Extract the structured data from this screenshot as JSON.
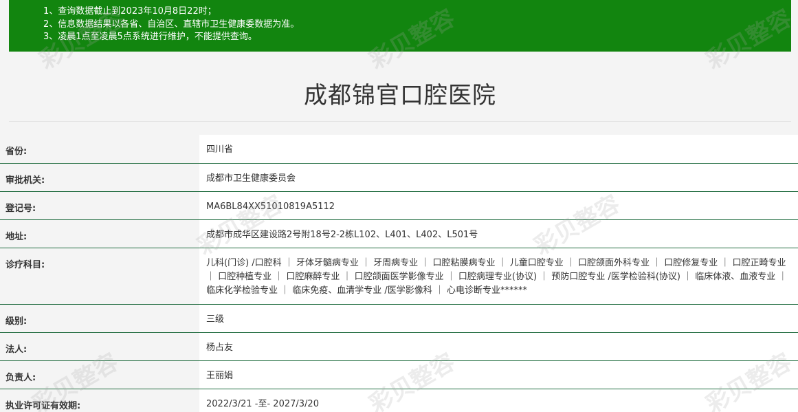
{
  "notice": {
    "line1": "1、查询数据截止到2023年10月8日22时；",
    "line2": "2、信息数据结果以各省、自治区、直辖市卫生健康委数据为准。",
    "line3": "3、凌晨1点至凌晨5点系统进行维护，不能提供查询。"
  },
  "hospital": {
    "name": "成都锦官口腔医院"
  },
  "rows": [
    {
      "label": "省份:",
      "value": "四川省"
    },
    {
      "label": "审批机关:",
      "value": "成都市卫生健康委员会"
    },
    {
      "label": "登记号:",
      "value": "MA6BL84XX51010819A5112"
    },
    {
      "label": "地址:",
      "value": "成都市成华区建设路2号附18号2-2栋L102、L401、L402、L501号"
    },
    {
      "label": "诊疗科目:",
      "value": "儿科(门诊) /口腔科 ｜ 牙体牙髓病专业 ｜ 牙周病专业 ｜ 口腔粘膜病专业 ｜ 儿童口腔专业 ｜ 口腔颌面外科专业 ｜ 口腔修复专业 ｜ 口腔正畸专业 ｜ 口腔种植专业 ｜ 口腔麻醉专业 ｜ 口腔颌面医学影像专业 ｜ 口腔病理专业(协议) ｜ 预防口腔专业 /医学检验科(协议) ｜ 临床体液、血液专业 ｜ 临床化学检验专业 ｜ 临床免疫、血清学专业 /医学影像科 ｜ 心电诊断专业******"
    },
    {
      "label": "级别:",
      "value": "三级"
    },
    {
      "label": "法人:",
      "value": "杨占友"
    },
    {
      "label": "负责人:",
      "value": "王丽娟"
    },
    {
      "label": "执业许可证有效期:",
      "value": "2022/3/21 -至- 2027/3/20"
    }
  ],
  "watermark_text": "彩贝整容",
  "colors": {
    "banner_green": "#12850f",
    "row_divider": "#1f6b3e"
  }
}
